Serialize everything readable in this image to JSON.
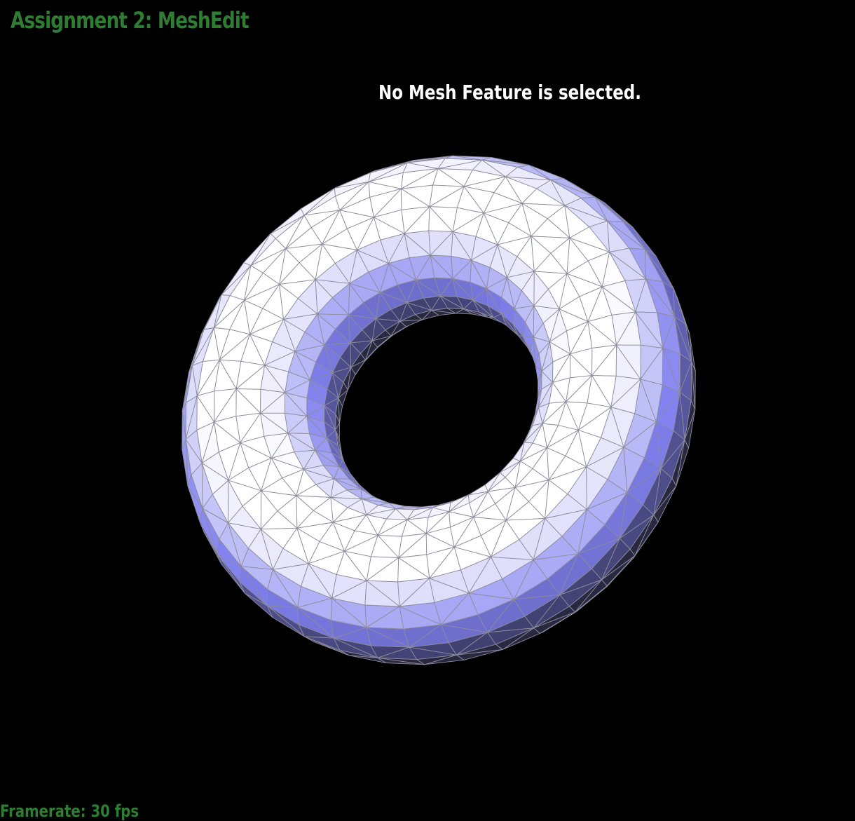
{
  "app": {
    "title": "Assignment 2: MeshEdit"
  },
  "status": {
    "message": "No Mesh Feature is selected."
  },
  "footer": {
    "framerate": "Framerate: 30 fps"
  },
  "colors": {
    "background": "#000000",
    "title": "#2e7d32",
    "status_text": "#ffffff",
    "mesh_base": "#8080f0",
    "mesh_highlight": "#ffffff",
    "mesh_shadow": "#282840",
    "wireframe": "#8c8c9c"
  },
  "mesh": {
    "shape": "torus",
    "selection": "none"
  }
}
